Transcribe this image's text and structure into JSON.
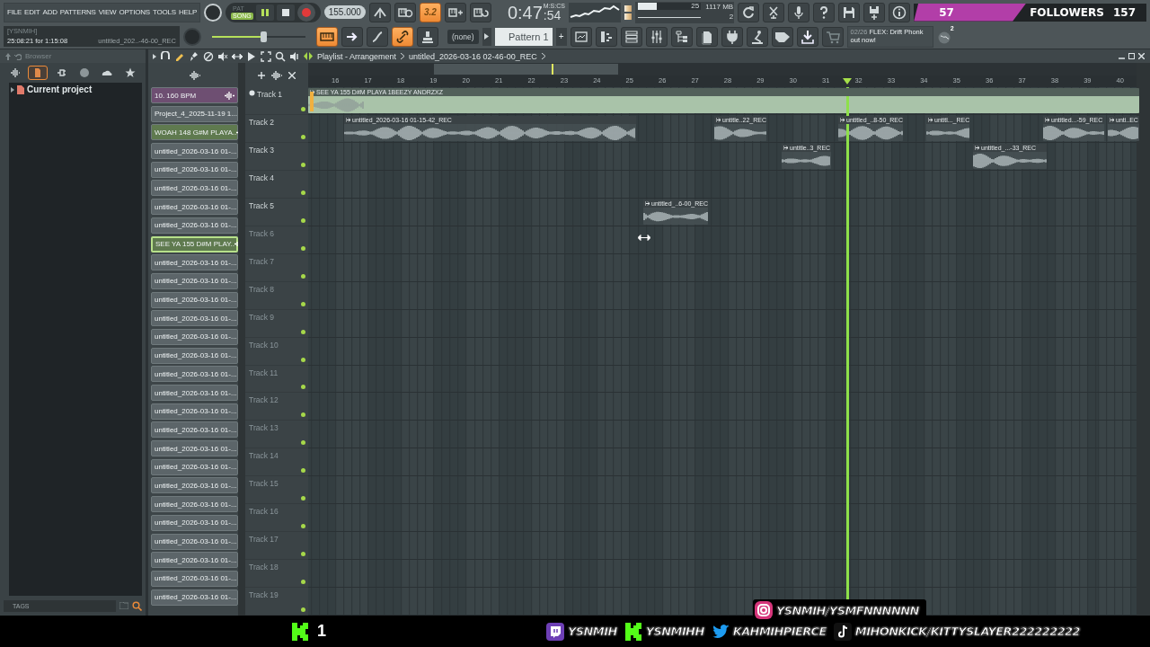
{
  "menu": [
    "FILE",
    "EDIT",
    "ADD",
    "PATTERNS",
    "VIEW",
    "OPTIONS",
    "TOOLS",
    "HELP"
  ],
  "transport": {
    "modes": [
      {
        "label": "PAT",
        "selected": false
      },
      {
        "label": "SONG",
        "selected": true
      }
    ],
    "tempo": "155.000"
  },
  "toggles": [
    {
      "on": false
    },
    {
      "on": false
    },
    {
      "on": true,
      "label": "3.2"
    },
    {
      "on": false
    },
    {
      "on": false
    }
  ],
  "time": {
    "main": "0:47",
    "sub": ":54",
    "format": "M:S:CS"
  },
  "monitor": {
    "cpu": "25",
    "memory": "1117 MB",
    "polyphony": "2"
  },
  "followers": {
    "count": "57",
    "label": "FOLLOWERS",
    "goal": "157"
  },
  "hint": {
    "user": "[YSNMIH]",
    "session": "25:08:21 for 1:15:08",
    "file": "untitled_202..-46-00_REC"
  },
  "master": {
    "level": 0.55
  },
  "tools": [
    {
      "on": true
    },
    {
      "on": false
    },
    {
      "on": false
    },
    {
      "on": true
    },
    {
      "on": false
    }
  ],
  "pattern_selector": {
    "none": "(none)",
    "pattern": "Pattern 1",
    "add": "+"
  },
  "news": {
    "date": "02/26",
    "text": "FLEX: Drift Phonk out now!",
    "badge": "2"
  },
  "browser": {
    "title": "Browser",
    "tabs": [
      {
        "selected": false
      },
      {
        "selected": true
      },
      {
        "selected": false
      },
      {
        "selected": false
      },
      {
        "selected": false
      },
      {
        "selected": false
      }
    ],
    "tree": [
      {
        "label": "Current project"
      }
    ],
    "tags": "TAGS"
  },
  "playlist": {
    "title": "Playlist - Arrangement",
    "pattern": "untitled_2026-03-16 02-46-00_REC",
    "ruler": [
      "16",
      "17",
      "18",
      "19",
      "20",
      "21",
      "22",
      "23",
      "24",
      "25",
      "26",
      "27",
      "28",
      "29",
      "30",
      "31",
      "32",
      "33",
      "34",
      "35",
      "36",
      "37",
      "38",
      "39",
      "40"
    ],
    "patterns": [
      {
        "label": "10. 160 BPM",
        "color": "#6e4f72",
        "kind": "audio",
        "selected": false
      },
      {
        "label": "Project_4_2025-11-19 1...",
        "color": "#5c6569",
        "kind": "plain",
        "selected": false
      },
      {
        "label": "WOAH 148 G#M PLAYA..",
        "color": "#5f7a4f",
        "kind": "audio",
        "selected": false
      },
      {
        "label": "untitled_2026-03-16 01-...",
        "color": "#5c6569",
        "kind": "plain",
        "selected": false
      },
      {
        "label": "untitled_2026-03-16 01-...",
        "color": "#5c6569",
        "kind": "plain",
        "selected": false
      },
      {
        "label": "untitled_2026-03-16 01-...",
        "color": "#5c6569",
        "kind": "plain",
        "selected": false
      },
      {
        "label": "untitled_2026-03-16 01-...",
        "color": "#5c6569",
        "kind": "plain",
        "selected": false
      },
      {
        "label": "untitled_2026-03-16 01-...",
        "color": "#5c6569",
        "kind": "plain",
        "selected": false
      },
      {
        "label": "SEE YA 155 D#M PLAY..",
        "color": "#5f7a4f",
        "kind": "audio",
        "selected": true
      },
      {
        "label": "untitled_2026-03-16 01-...",
        "color": "#5c6569",
        "kind": "plain",
        "selected": false
      },
      {
        "label": "untitled_2026-03-16 01-...",
        "color": "#5c6569",
        "kind": "plain",
        "selected": false
      },
      {
        "label": "untitled_2026-03-16 01-...",
        "color": "#5c6569",
        "kind": "plain",
        "selected": false
      },
      {
        "label": "untitled_2026-03-16 01-...",
        "color": "#5c6569",
        "kind": "plain",
        "selected": false
      },
      {
        "label": "untitled_2026-03-16 01-...",
        "color": "#5c6569",
        "kind": "plain",
        "selected": false
      },
      {
        "label": "untitled_2026-03-16 01-...",
        "color": "#5c6569",
        "kind": "plain",
        "selected": false
      },
      {
        "label": "untitled_2026-03-16 01-...",
        "color": "#5c6569",
        "kind": "plain",
        "selected": false
      },
      {
        "label": "untitled_2026-03-16 01-...",
        "color": "#5c6569",
        "kind": "plain",
        "selected": false
      },
      {
        "label": "untitled_2026-03-16 01-...",
        "color": "#5c6569",
        "kind": "plain",
        "selected": false
      },
      {
        "label": "untitled_2026-03-16 01-...",
        "color": "#5c6569",
        "kind": "plain",
        "selected": false
      },
      {
        "label": "untitled_2026-03-16 01-...",
        "color": "#5c6569",
        "kind": "plain",
        "selected": false
      },
      {
        "label": "untitled_2026-03-16 01-...",
        "color": "#5c6569",
        "kind": "plain",
        "selected": false
      },
      {
        "label": "untitled_2026-03-16 01-...",
        "color": "#5c6569",
        "kind": "plain",
        "selected": false
      },
      {
        "label": "untitled_2026-03-16 01-...",
        "color": "#5c6569",
        "kind": "plain",
        "selected": false
      },
      {
        "label": "untitled_2026-03-16 01-...",
        "color": "#5c6569",
        "kind": "plain",
        "selected": false
      },
      {
        "label": "untitled_2026-03-16 01-...",
        "color": "#5c6569",
        "kind": "plain",
        "selected": false
      },
      {
        "label": "untitled_2026-03-16 01-...",
        "color": "#5c6569",
        "kind": "plain",
        "selected": false
      },
      {
        "label": "untitled_2026-03-16 01-...",
        "color": "#5c6569",
        "kind": "plain",
        "selected": false
      },
      {
        "label": "untitled_2026-03-16 01-...",
        "color": "#5c6569",
        "kind": "plain",
        "selected": false
      }
    ],
    "tracks": [
      {
        "label": "Track 1",
        "empty": false,
        "clips": [
          {
            "label": "SEE YA 155 D#M PLAYA 1BEEZY ANDRZXZ",
            "kind": "full"
          }
        ]
      },
      {
        "label": "Track 2",
        "empty": false,
        "clips": [
          {
            "label": "untitled_2026-03-16 01-15-42_REC",
            "kind": "rec"
          },
          {
            "label": "untitle..22_REC",
            "kind": "rec"
          },
          {
            "label": "untitled_..8-50_REC",
            "kind": "rec"
          },
          {
            "label": "untitl..._REC",
            "kind": "rec"
          },
          {
            "label": "untitled...-59_REC",
            "kind": "rec"
          },
          {
            "label": "unti..EC",
            "kind": "rec"
          }
        ]
      },
      {
        "label": "Track 3",
        "empty": false,
        "clips": [
          {
            "label": "untitle..3_REC",
            "kind": "rec"
          },
          {
            "label": "untitled_...-33_REC",
            "kind": "rec"
          }
        ]
      },
      {
        "label": "Track 4",
        "empty": false
      },
      {
        "label": "Track 5",
        "empty": false,
        "clips": [
          {
            "label": "untitled_..6-00_REC",
            "kind": "rec"
          }
        ]
      },
      {
        "label": "Track 6",
        "empty": true
      },
      {
        "label": "Track 7",
        "empty": true
      },
      {
        "label": "Track 8",
        "empty": true
      },
      {
        "label": "Track 9",
        "empty": true
      },
      {
        "label": "Track 10",
        "empty": true
      },
      {
        "label": "Track 11",
        "empty": true
      },
      {
        "label": "Track 12",
        "empty": true
      },
      {
        "label": "Track 13",
        "empty": true
      },
      {
        "label": "Track 14",
        "empty": true
      },
      {
        "label": "Track 15",
        "empty": true
      },
      {
        "label": "Track 16",
        "empty": true
      },
      {
        "label": "Track 17",
        "empty": true
      },
      {
        "label": "Track 18",
        "empty": true
      },
      {
        "label": "Track 19",
        "empty": true
      }
    ]
  },
  "overlay": {
    "kick_count": "1",
    "socials": [
      {
        "kind": "instagram",
        "handle": "YSNMIH/YSMFNNNNNN"
      },
      {
        "kind": "twitch",
        "handle": "YSNMIH"
      },
      {
        "kind": "kick",
        "handle": "YSNMIHH"
      },
      {
        "kind": "twitter",
        "handle": "KAHMIHPIERCE"
      },
      {
        "kind": "tiktok",
        "handle": "MIHONKICK/KITTYSLAYER222222222"
      }
    ]
  }
}
